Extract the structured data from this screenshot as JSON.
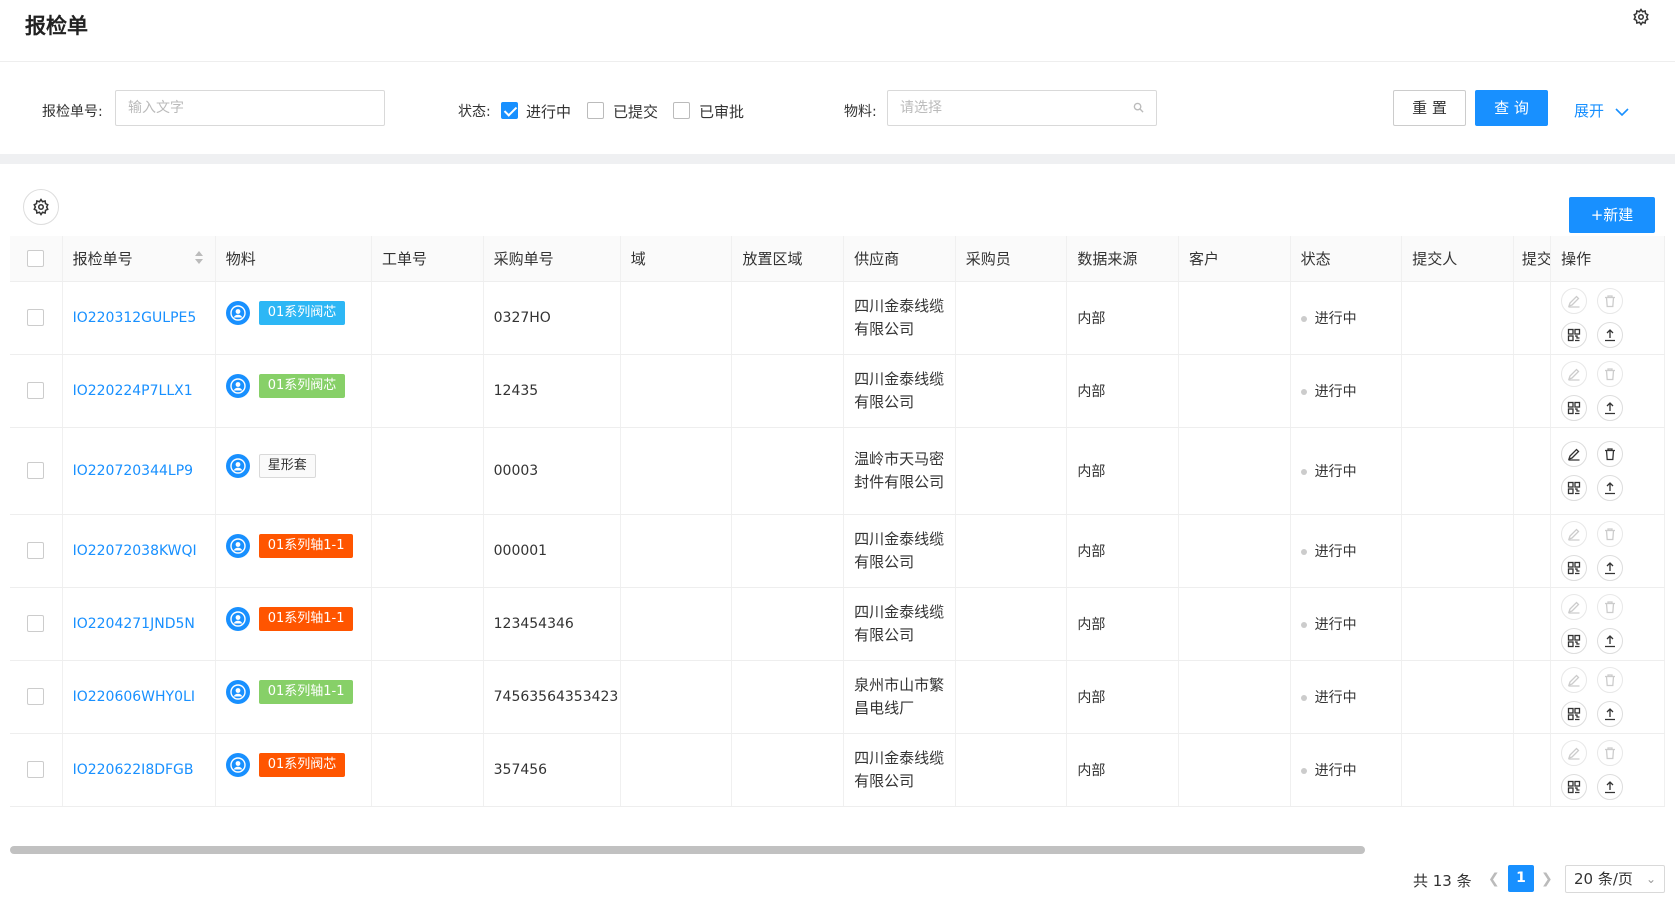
{
  "header": {
    "title": "报检单"
  },
  "filters": {
    "order_no_label": "报检单号:",
    "order_no_placeholder": "输入文字",
    "status_label": "状态:",
    "status_options": [
      {
        "label": "进行中",
        "checked": true
      },
      {
        "label": "已提交",
        "checked": false
      },
      {
        "label": "已审批",
        "checked": false
      }
    ],
    "material_label": "物料:",
    "material_placeholder": "请选择",
    "reset_label": "重 置",
    "query_label": "查 询",
    "expand_label": "展开"
  },
  "toolbar": {
    "new_label": "+新建"
  },
  "table": {
    "columns": [
      "报检单号",
      "物料",
      "工单号",
      "采购单号",
      "域",
      "放置区域",
      "供应商",
      "采购员",
      "数据来源",
      "客户",
      "状态",
      "提交人",
      "提交",
      "操作"
    ],
    "rows": [
      {
        "id": "IO220312GULPE5",
        "material": "01系列阀芯",
        "tag_color": "blue",
        "work_order": "",
        "purchase_no": "0327HO",
        "domain": "",
        "area": "",
        "supplier": "四川金泰线缆有限公司",
        "buyer": "",
        "source": "内部",
        "customer": "",
        "status": "进行中",
        "submitter": "",
        "ops_enabled": false
      },
      {
        "id": "IO220224P7LLX1",
        "material": "01系列阀芯",
        "tag_color": "green",
        "work_order": "",
        "purchase_no": "12435",
        "domain": "",
        "area": "",
        "supplier": "四川金泰线缆有限公司",
        "buyer": "",
        "source": "内部",
        "customer": "",
        "status": "进行中",
        "submitter": "",
        "ops_enabled": false
      },
      {
        "id": "IO220720344LP9",
        "material": "星形套",
        "tag_color": "plain",
        "work_order": "",
        "purchase_no": "00003",
        "domain": "",
        "area": "",
        "supplier": "温岭市天马密封件有限公司",
        "buyer": "",
        "source": "内部",
        "customer": "",
        "status": "进行中",
        "submitter": "",
        "ops_enabled": true
      },
      {
        "id": "IO22072038KWQI",
        "material": "01系列轴1-1",
        "tag_color": "red",
        "work_order": "",
        "purchase_no": "000001",
        "domain": "",
        "area": "",
        "supplier": "四川金泰线缆有限公司",
        "buyer": "",
        "source": "内部",
        "customer": "",
        "status": "进行中",
        "submitter": "",
        "ops_enabled": false
      },
      {
        "id": "IO2204271JND5N",
        "material": "01系列轴1-1",
        "tag_color": "red",
        "work_order": "",
        "purchase_no": "123454346",
        "domain": "",
        "area": "",
        "supplier": "四川金泰线缆有限公司",
        "buyer": "",
        "source": "内部",
        "customer": "",
        "status": "进行中",
        "submitter": "",
        "ops_enabled": false
      },
      {
        "id": "IO220606WHY0LI",
        "material": "01系列轴1-1",
        "tag_color": "green",
        "work_order": "",
        "purchase_no": "74563564353423",
        "domain": "",
        "area": "",
        "supplier": "泉州市山市繁昌电线厂",
        "buyer": "",
        "source": "内部",
        "customer": "",
        "status": "进行中",
        "submitter": "",
        "ops_enabled": false
      },
      {
        "id": "IO220622I8DFGB",
        "material": "01系列阀芯",
        "tag_color": "red",
        "work_order": "",
        "purchase_no": "357456",
        "domain": "",
        "area": "",
        "supplier": "四川金泰线缆有限公司",
        "buyer": "",
        "source": "内部",
        "customer": "",
        "status": "进行中",
        "submitter": "",
        "ops_enabled": false
      }
    ]
  },
  "pagination": {
    "total_label": "共 13 条",
    "current_page": "1",
    "page_size_label": "20 条/页"
  },
  "colors": {
    "primary": "#1890ff",
    "tag_blue": "#2db7f5",
    "tag_green": "#87d068",
    "tag_red": "#ff5500"
  },
  "icons": [
    "settings-gear-icon",
    "chevron-down-icon",
    "search-icon",
    "user-avatar-icon",
    "edit-icon",
    "delete-icon",
    "qrcode-icon",
    "upload-icon"
  ]
}
